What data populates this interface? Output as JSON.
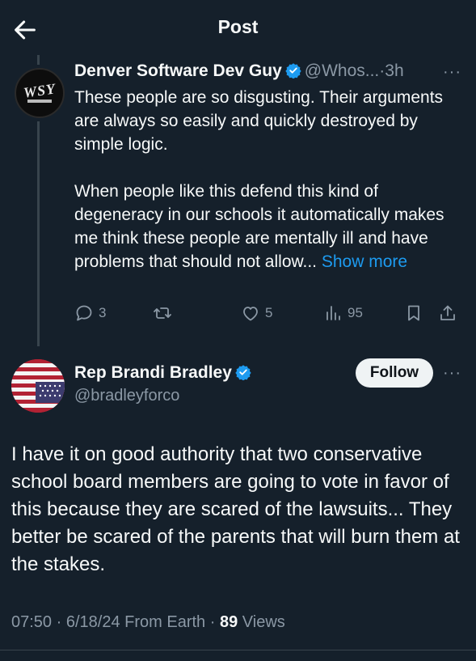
{
  "header": {
    "title": "Post"
  },
  "quoted": {
    "name": "Denver Software Dev Guy",
    "handle": "@Whos...",
    "sep": "·",
    "time": "3h",
    "more": "···",
    "avatar_text": "WSY",
    "para1": "These people are so disgusting. Their arguments are always so easily and quickly destroyed by simple logic.",
    "para2": "When people like this defend this kind of degeneracy in our schools it automatically makes me think these people are mentally ill and have problems that should not allow...",
    "show_more": "Show more",
    "replies": "3",
    "likes": "5",
    "views": "95"
  },
  "post": {
    "name": "Rep Brandi Bradley",
    "handle": "@bradleyforco",
    "follow_label": "Follow",
    "more": "···",
    "text": "I have it on good authority that two conservative school board members are going to vote in favor of this because they are scared of the lawsuits... They better be scared of the parents that will burn them at the stakes.",
    "time": "07:50",
    "date": "6/18/24",
    "source": "From Earth",
    "views_count": "89",
    "views_label": "Views",
    "dot": "·"
  },
  "colors": {
    "background": "#15202b",
    "accent": "#1d9bf0",
    "muted": "#8b98a5",
    "verified": "#1d9bf0"
  },
  "icons": [
    "back-arrow-icon",
    "verified-badge-icon",
    "reply-icon",
    "repost-icon",
    "like-icon",
    "views-icon",
    "bookmark-icon",
    "share-icon",
    "more-icon"
  ]
}
